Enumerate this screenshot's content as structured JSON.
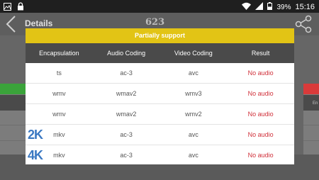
{
  "status_bar": {
    "battery": "39%",
    "time": "15:16"
  },
  "app": {
    "title": "Details",
    "count": "623"
  },
  "background": {
    "right_header_text": "En"
  },
  "dialog": {
    "title": "Partially support",
    "headers": [
      "Encapsulation",
      "Audio Coding",
      "Video Coding",
      "Result"
    ],
    "rows": [
      {
        "badge": "",
        "encapsulation": "ts",
        "audio": "ac-3",
        "video": "avc",
        "result": "No audio"
      },
      {
        "badge": "",
        "encapsulation": "wmv",
        "audio": "wmav2",
        "video": "wmv3",
        "result": "No audio"
      },
      {
        "badge": "",
        "encapsulation": "wmv",
        "audio": "wmav2",
        "video": "wmv2",
        "result": "No audio"
      },
      {
        "badge": "2K",
        "encapsulation": "mkv",
        "audio": "ac-3",
        "video": "avc",
        "result": "No audio"
      },
      {
        "badge": "4K",
        "encapsulation": "mkv",
        "audio": "ac-3",
        "video": "avc",
        "result": "No audio"
      }
    ]
  },
  "colors": {
    "dialog_title_bg": "#e2c415",
    "header_bg": "#4a4a4a",
    "result_text": "#d0303a",
    "badge": "#3a78c2"
  }
}
